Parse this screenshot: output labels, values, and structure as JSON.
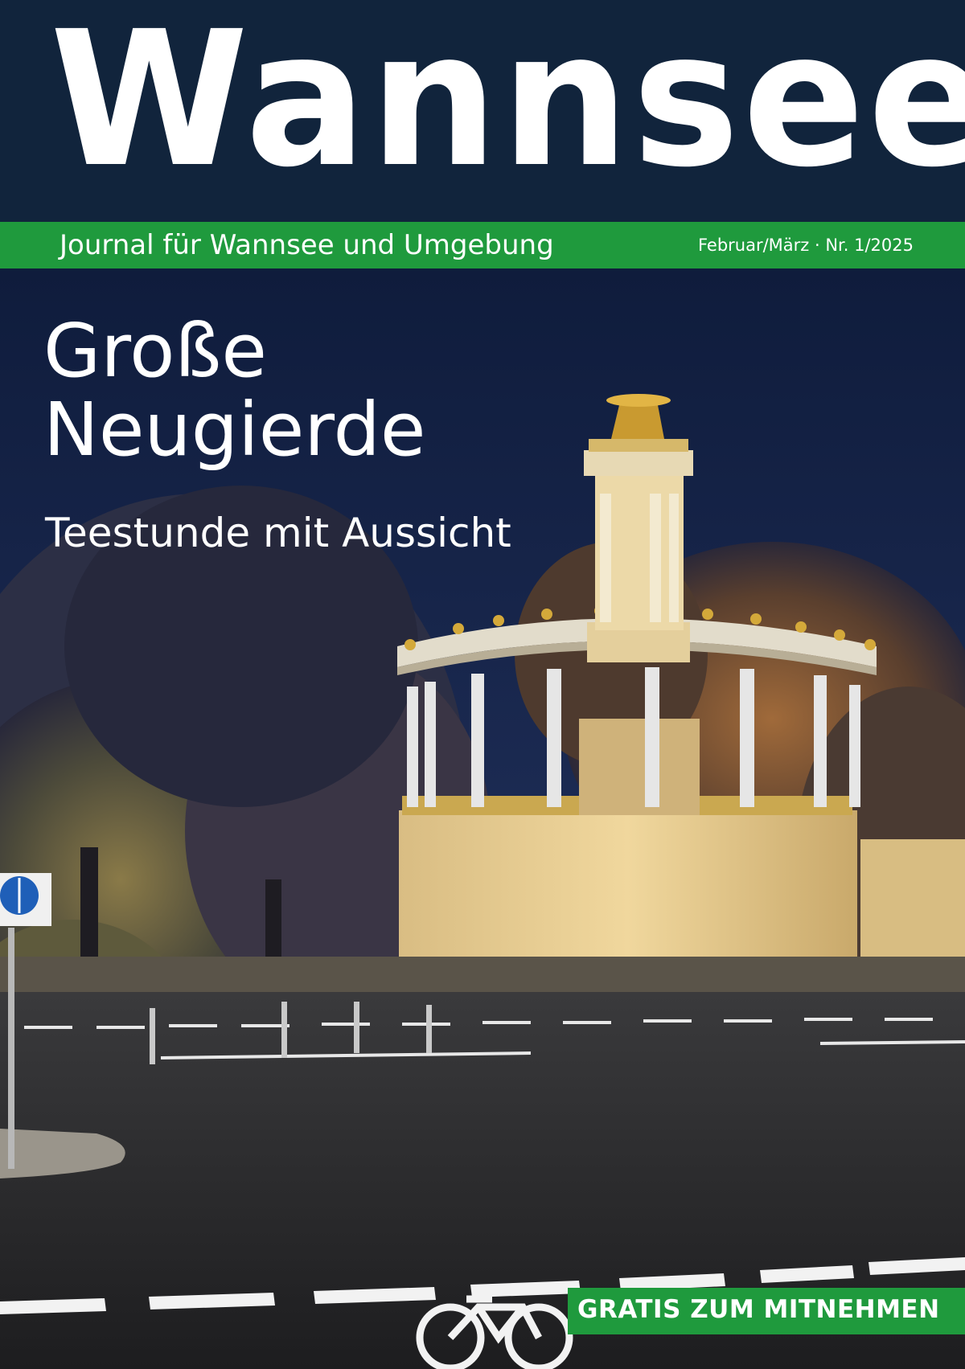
{
  "masthead": {
    "title": "Wannsee",
    "tagline": "Journal für Wannsee und Umgebung",
    "issue": "Februar/März · Nr. 1/2025"
  },
  "cover_story": {
    "headline_line1": "Große",
    "headline_line2": "Neugierde",
    "subheadline": "Teestunde mit Aussicht"
  },
  "badge": {
    "label": "GRATIS ZUM MITNEHMEN"
  },
  "photo": {
    "subject": "night-pavilion-photo",
    "icons": [
      "bicycle-road-marking-icon",
      "bike-pedestrian-sign-icon"
    ]
  },
  "colors": {
    "masthead_bg": "#11243c",
    "brand_green": "#1f9a3d",
    "text": "#ffffff"
  }
}
